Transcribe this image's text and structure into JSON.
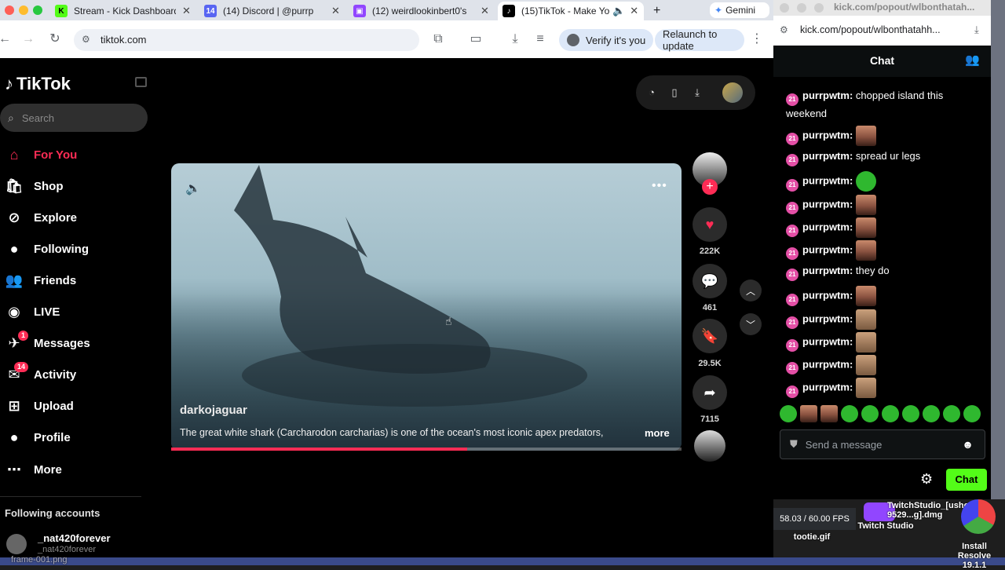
{
  "browser": {
    "tabs": [
      {
        "title": "Stream - Kick Dashboard",
        "icon_color": "#53fc18",
        "icon_glyph": "K"
      },
      {
        "title": "(14) Discord | @purrp",
        "icon_color": "#5865f2",
        "icon_glyph": "14"
      },
      {
        "title": "(12) weirdlookinbert0's",
        "icon_color": "#9146ff",
        "icon_glyph": "▣"
      },
      {
        "title": "(15)TikTok - Make Yo",
        "icon_color": "#000000",
        "icon_glyph": "♪"
      }
    ],
    "gemini_label": "Gemini",
    "url": "tiktok.com",
    "verify_label": "Verify it's you",
    "relaunch_label": "Relaunch to update"
  },
  "tiktok": {
    "logo": "TikTok",
    "search_placeholder": "Search",
    "nav": [
      {
        "label": "For You",
        "icon": "home-icon",
        "active": true
      },
      {
        "label": "Shop",
        "icon": "shop-icon"
      },
      {
        "label": "Explore",
        "icon": "compass-icon"
      },
      {
        "label": "Following",
        "icon": "following-avatar-icon"
      },
      {
        "label": "Friends",
        "icon": "friends-icon"
      },
      {
        "label": "LIVE",
        "icon": "live-icon"
      },
      {
        "label": "Messages",
        "icon": "messages-icon",
        "badge": "1"
      },
      {
        "label": "Activity",
        "icon": "activity-icon",
        "badge": "14"
      },
      {
        "label": "Upload",
        "icon": "upload-icon"
      },
      {
        "label": "Profile",
        "icon": "profile-avatar-icon"
      },
      {
        "label": "More",
        "icon": "more-icon"
      }
    ],
    "following_header": "Following accounts",
    "following": [
      {
        "name": "_nat420forever",
        "handle": "_nat420forever"
      }
    ],
    "video": {
      "author": "darkojaguar",
      "caption": "The great white shark (Carcharodon carcharias) is one of the ocean's most iconic apex predators,",
      "more": "more",
      "progress": 0.58
    },
    "actions": {
      "likes": "222K",
      "comments": "461",
      "saves": "29.5K",
      "shares": "7115"
    }
  },
  "kick": {
    "popup_title": "kick.com/popout/wlbonthatah...",
    "popup_url": "kick.com/popout/wlbonthatahh...",
    "chat_header": "Chat",
    "messages": [
      {
        "user": "purrpwtm:",
        "text": "chopped island this weekend",
        "emote": ""
      },
      {
        "user": "purrpwtm:",
        "text": "",
        "emote": "face"
      },
      {
        "user": "purrpwtm:",
        "text": "spread ur legs",
        "emote": ""
      },
      {
        "user": "purrpwtm:",
        "text": "",
        "emote": "frog"
      },
      {
        "user": "purrpwtm:",
        "text": "",
        "emote": "face"
      },
      {
        "user": "purrpwtm:",
        "text": "",
        "emote": "face"
      },
      {
        "user": "purrpwtm:",
        "text": "",
        "emote": "face"
      },
      {
        "user": "purrpwtm:",
        "text": "they do",
        "emote": ""
      },
      {
        "user": "purrpwtm:",
        "text": "",
        "emote": "face"
      },
      {
        "user": "purrpwtm:",
        "text": "",
        "emote": "man"
      },
      {
        "user": "purrpwtm:",
        "text": "",
        "emote": "man"
      },
      {
        "user": "purrpwtm:",
        "text": "",
        "emote": "man"
      },
      {
        "user": "purrpwtm:",
        "text": "",
        "emote": "man"
      }
    ],
    "sub_badge": "21",
    "input_placeholder": "Send a message",
    "chat_button": "Chat"
  },
  "desktop": {
    "fps": "58.03 / 60.00 FPS",
    "files": [
      "tootie.gif",
      "frame-001.png",
      "TwitchStudio_[usher-9529...g].dmg",
      "Install Resolve 19.1.1"
    ],
    "twitch_studio_label": "Twitch Studio"
  },
  "colors": {
    "tiktok_red": "#fe2c55",
    "kick_green": "#53fc18",
    "sub_pink": "#e44fa6"
  }
}
